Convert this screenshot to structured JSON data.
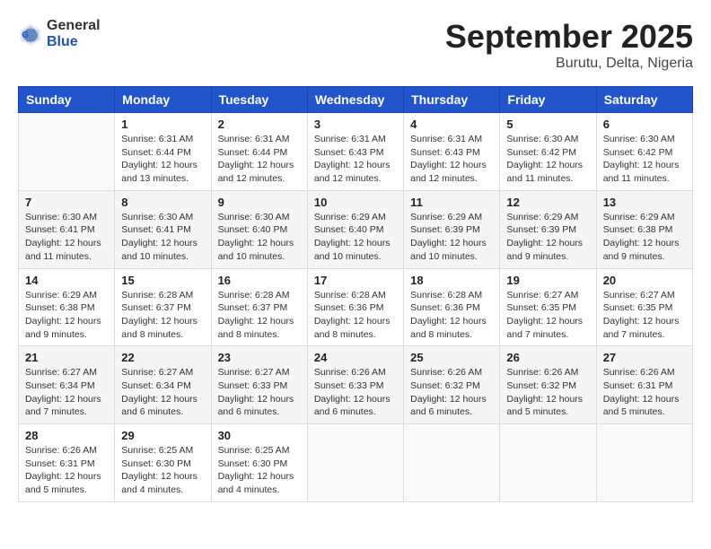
{
  "header": {
    "logo_general": "General",
    "logo_blue": "Blue",
    "month_title": "September 2025",
    "location": "Burutu, Delta, Nigeria"
  },
  "weekdays": [
    "Sunday",
    "Monday",
    "Tuesday",
    "Wednesday",
    "Thursday",
    "Friday",
    "Saturday"
  ],
  "weeks": [
    [
      {
        "day": "",
        "sunrise": "",
        "sunset": "",
        "daylight": ""
      },
      {
        "day": "1",
        "sunrise": "Sunrise: 6:31 AM",
        "sunset": "Sunset: 6:44 PM",
        "daylight": "Daylight: 12 hours and 13 minutes."
      },
      {
        "day": "2",
        "sunrise": "Sunrise: 6:31 AM",
        "sunset": "Sunset: 6:44 PM",
        "daylight": "Daylight: 12 hours and 12 minutes."
      },
      {
        "day": "3",
        "sunrise": "Sunrise: 6:31 AM",
        "sunset": "Sunset: 6:43 PM",
        "daylight": "Daylight: 12 hours and 12 minutes."
      },
      {
        "day": "4",
        "sunrise": "Sunrise: 6:31 AM",
        "sunset": "Sunset: 6:43 PM",
        "daylight": "Daylight: 12 hours and 12 minutes."
      },
      {
        "day": "5",
        "sunrise": "Sunrise: 6:30 AM",
        "sunset": "Sunset: 6:42 PM",
        "daylight": "Daylight: 12 hours and 11 minutes."
      },
      {
        "day": "6",
        "sunrise": "Sunrise: 6:30 AM",
        "sunset": "Sunset: 6:42 PM",
        "daylight": "Daylight: 12 hours and 11 minutes."
      }
    ],
    [
      {
        "day": "7",
        "sunrise": "Sunrise: 6:30 AM",
        "sunset": "Sunset: 6:41 PM",
        "daylight": "Daylight: 12 hours and 11 minutes."
      },
      {
        "day": "8",
        "sunrise": "Sunrise: 6:30 AM",
        "sunset": "Sunset: 6:41 PM",
        "daylight": "Daylight: 12 hours and 10 minutes."
      },
      {
        "day": "9",
        "sunrise": "Sunrise: 6:30 AM",
        "sunset": "Sunset: 6:40 PM",
        "daylight": "Daylight: 12 hours and 10 minutes."
      },
      {
        "day": "10",
        "sunrise": "Sunrise: 6:29 AM",
        "sunset": "Sunset: 6:40 PM",
        "daylight": "Daylight: 12 hours and 10 minutes."
      },
      {
        "day": "11",
        "sunrise": "Sunrise: 6:29 AM",
        "sunset": "Sunset: 6:39 PM",
        "daylight": "Daylight: 12 hours and 10 minutes."
      },
      {
        "day": "12",
        "sunrise": "Sunrise: 6:29 AM",
        "sunset": "Sunset: 6:39 PM",
        "daylight": "Daylight: 12 hours and 9 minutes."
      },
      {
        "day": "13",
        "sunrise": "Sunrise: 6:29 AM",
        "sunset": "Sunset: 6:38 PM",
        "daylight": "Daylight: 12 hours and 9 minutes."
      }
    ],
    [
      {
        "day": "14",
        "sunrise": "Sunrise: 6:29 AM",
        "sunset": "Sunset: 6:38 PM",
        "daylight": "Daylight: 12 hours and 9 minutes."
      },
      {
        "day": "15",
        "sunrise": "Sunrise: 6:28 AM",
        "sunset": "Sunset: 6:37 PM",
        "daylight": "Daylight: 12 hours and 8 minutes."
      },
      {
        "day": "16",
        "sunrise": "Sunrise: 6:28 AM",
        "sunset": "Sunset: 6:37 PM",
        "daylight": "Daylight: 12 hours and 8 minutes."
      },
      {
        "day": "17",
        "sunrise": "Sunrise: 6:28 AM",
        "sunset": "Sunset: 6:36 PM",
        "daylight": "Daylight: 12 hours and 8 minutes."
      },
      {
        "day": "18",
        "sunrise": "Sunrise: 6:28 AM",
        "sunset": "Sunset: 6:36 PM",
        "daylight": "Daylight: 12 hours and 8 minutes."
      },
      {
        "day": "19",
        "sunrise": "Sunrise: 6:27 AM",
        "sunset": "Sunset: 6:35 PM",
        "daylight": "Daylight: 12 hours and 7 minutes."
      },
      {
        "day": "20",
        "sunrise": "Sunrise: 6:27 AM",
        "sunset": "Sunset: 6:35 PM",
        "daylight": "Daylight: 12 hours and 7 minutes."
      }
    ],
    [
      {
        "day": "21",
        "sunrise": "Sunrise: 6:27 AM",
        "sunset": "Sunset: 6:34 PM",
        "daylight": "Daylight: 12 hours and 7 minutes."
      },
      {
        "day": "22",
        "sunrise": "Sunrise: 6:27 AM",
        "sunset": "Sunset: 6:34 PM",
        "daylight": "Daylight: 12 hours and 6 minutes."
      },
      {
        "day": "23",
        "sunrise": "Sunrise: 6:27 AM",
        "sunset": "Sunset: 6:33 PM",
        "daylight": "Daylight: 12 hours and 6 minutes."
      },
      {
        "day": "24",
        "sunrise": "Sunrise: 6:26 AM",
        "sunset": "Sunset: 6:33 PM",
        "daylight": "Daylight: 12 hours and 6 minutes."
      },
      {
        "day": "25",
        "sunrise": "Sunrise: 6:26 AM",
        "sunset": "Sunset: 6:32 PM",
        "daylight": "Daylight: 12 hours and 6 minutes."
      },
      {
        "day": "26",
        "sunrise": "Sunrise: 6:26 AM",
        "sunset": "Sunset: 6:32 PM",
        "daylight": "Daylight: 12 hours and 5 minutes."
      },
      {
        "day": "27",
        "sunrise": "Sunrise: 6:26 AM",
        "sunset": "Sunset: 6:31 PM",
        "daylight": "Daylight: 12 hours and 5 minutes."
      }
    ],
    [
      {
        "day": "28",
        "sunrise": "Sunrise: 6:26 AM",
        "sunset": "Sunset: 6:31 PM",
        "daylight": "Daylight: 12 hours and 5 minutes."
      },
      {
        "day": "29",
        "sunrise": "Sunrise: 6:25 AM",
        "sunset": "Sunset: 6:30 PM",
        "daylight": "Daylight: 12 hours and 4 minutes."
      },
      {
        "day": "30",
        "sunrise": "Sunrise: 6:25 AM",
        "sunset": "Sunset: 6:30 PM",
        "daylight": "Daylight: 12 hours and 4 minutes."
      },
      {
        "day": "",
        "sunrise": "",
        "sunset": "",
        "daylight": ""
      },
      {
        "day": "",
        "sunrise": "",
        "sunset": "",
        "daylight": ""
      },
      {
        "day": "",
        "sunrise": "",
        "sunset": "",
        "daylight": ""
      },
      {
        "day": "",
        "sunrise": "",
        "sunset": "",
        "daylight": ""
      }
    ]
  ]
}
